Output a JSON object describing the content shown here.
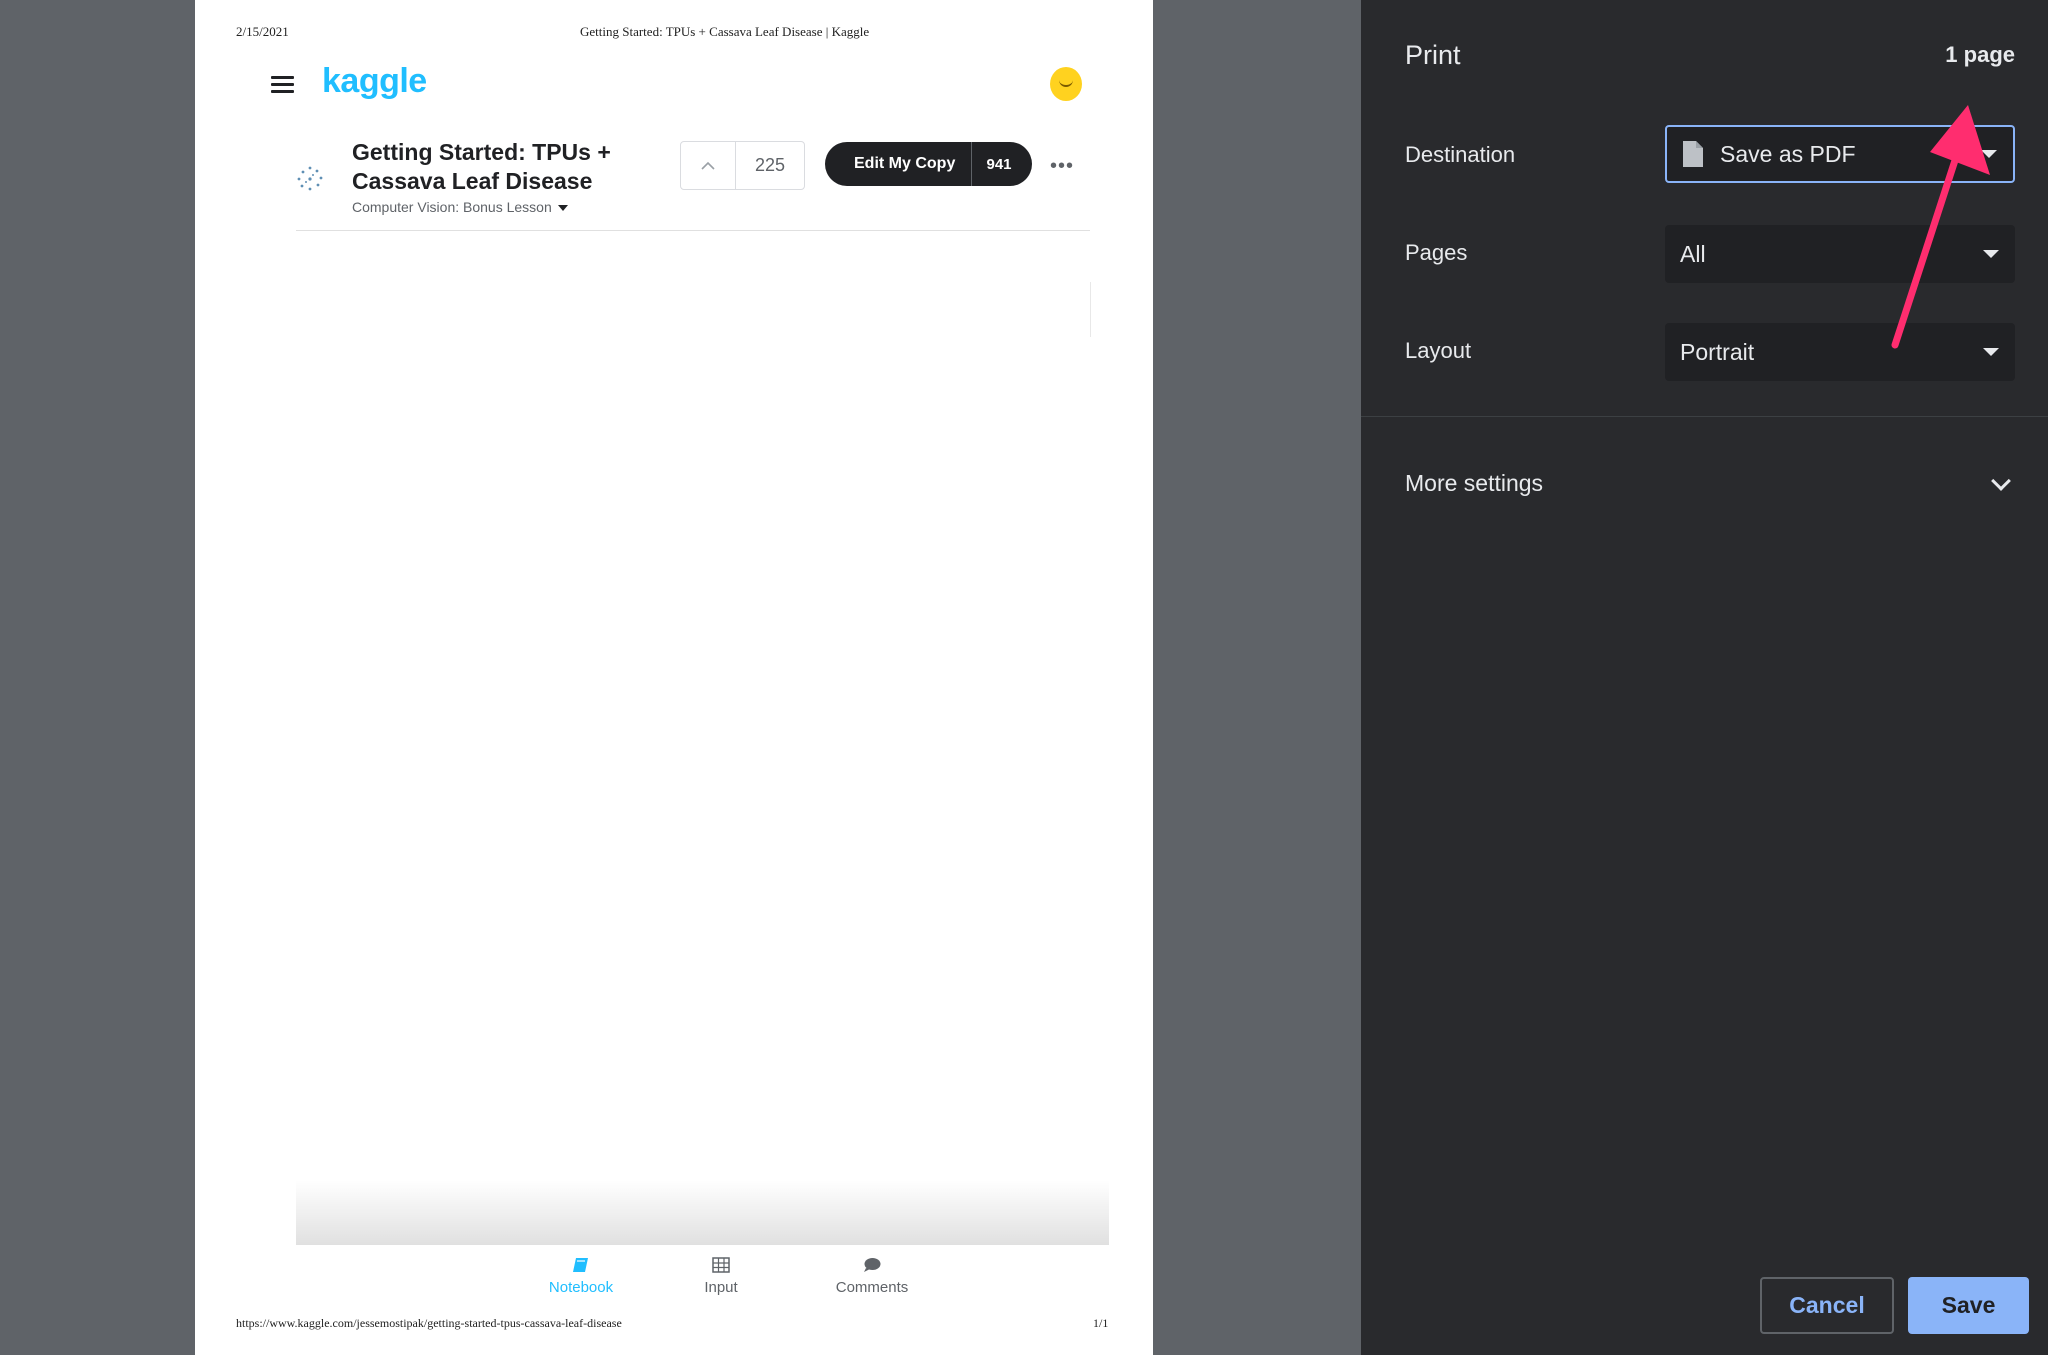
{
  "preview": {
    "header_date": "2/15/2021",
    "header_title": "Getting Started: TPUs + Cassava Leaf Disease | Kaggle",
    "footer_url": "https://www.kaggle.com/jessemostipak/getting-started-tpus-cassava-leaf-disease",
    "footer_page": "1/1",
    "logo_text": "kaggle",
    "notebook": {
      "title": "Getting Started: TPUs + Cassava Leaf Disease",
      "subtitle": "Computer Vision: Bonus Lesson",
      "vote_count": "225",
      "edit_label": "Edit My Copy",
      "copy_count": "941",
      "more_label": "•••"
    },
    "tabs": [
      {
        "label": "Notebook",
        "icon": "book-icon"
      },
      {
        "label": "Input",
        "icon": "table-icon"
      },
      {
        "label": "Comments",
        "icon": "comment-icon"
      }
    ],
    "accent_color": "#20beff"
  },
  "print_panel": {
    "title": "Print",
    "page_count": "1 page",
    "destination": {
      "label": "Destination",
      "value": "Save as PDF",
      "icon": "document-icon"
    },
    "pages": {
      "label": "Pages",
      "value": "All"
    },
    "layout": {
      "label": "Layout",
      "value": "Portrait"
    },
    "more_settings_label": "More settings",
    "cancel_label": "Cancel",
    "save_label": "Save",
    "accent_color": "#8ab4f8"
  },
  "annotation": {
    "color": "#ff2d6f",
    "icon": "arrow-annotation"
  }
}
